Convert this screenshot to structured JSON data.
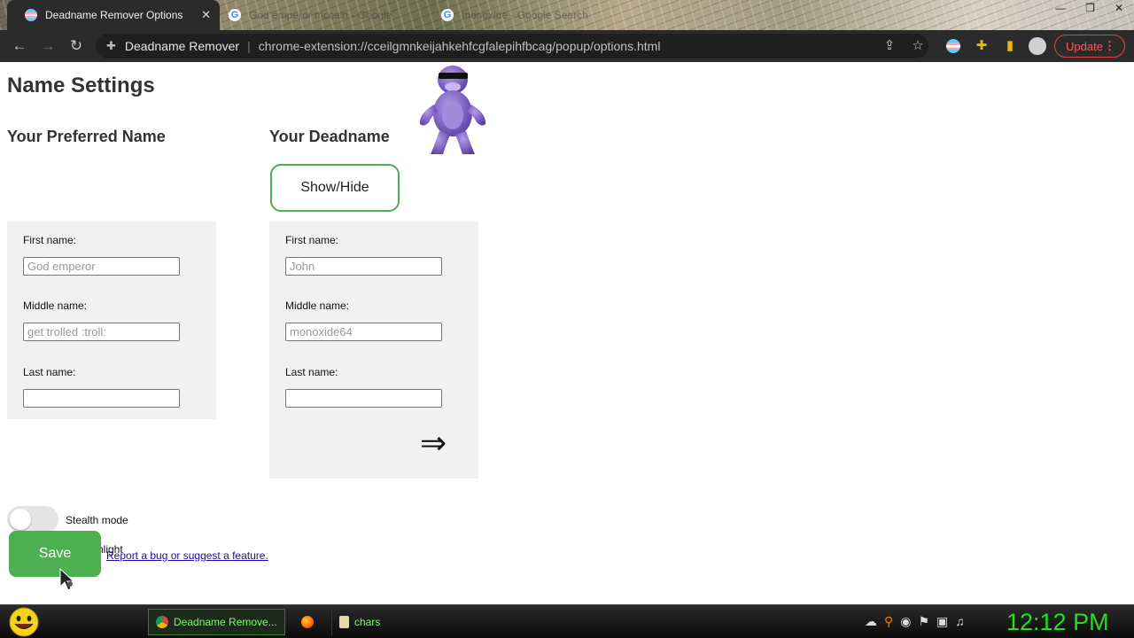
{
  "browser": {
    "tabs": [
      {
        "title": "Deadname Remover Options",
        "favicon": "trans-flag-icon",
        "active": true,
        "close": "✕"
      },
      {
        "title": "God emperor mccain - Google",
        "favicon": "google-icon",
        "active": false
      },
      {
        "title": "monoxide - Google Search",
        "favicon": "google-icon",
        "active": false
      }
    ],
    "window_controls": [
      "—",
      "❐",
      "✕"
    ],
    "toolbar": {
      "site_name": "Deadname Remover",
      "url": "chrome-extension://cceilgmnkeijahkehfcgfalepihfbcag/popup/options.html",
      "update_label": "Update",
      "menu_dots": "⋮"
    }
  },
  "page": {
    "title": "Name Settings",
    "preferred_heading": "Your Preferred Name",
    "deadname_heading": "Your Deadname",
    "show_hide_label": "Show/Hide",
    "preferred": {
      "first_label": "First name:",
      "first_value": "God emperor",
      "middle_label": "Middle name:",
      "middle_value": "get trolled :troll:",
      "last_label": "Last name:",
      "last_value": ""
    },
    "deadname": {
      "first_label": "First name:",
      "first_value": "John",
      "middle_label": "Middle name:",
      "middle_value": "monoxide64",
      "last_label": "Last name:",
      "last_value": ""
    },
    "arrow": "⇒",
    "stealth_label": "Stealth mode",
    "stealth_on": false,
    "highlight_label": "hlight",
    "report_link": "Report a bug or suggest a feature.",
    "save_label": "Save"
  },
  "taskbar": {
    "items": [
      {
        "label": "Deadname Remove...",
        "icon": "chrome-icon",
        "active": true
      },
      {
        "label": "",
        "icon": "firefox-icon",
        "active": false
      },
      {
        "label": "chars",
        "icon": "notepad-icon",
        "active": false
      }
    ],
    "clock": "12:12 PM"
  },
  "colors": {
    "accent_green": "#4caf50",
    "update_red": "#e0463f",
    "clock_green": "#20e020",
    "link_blue": "#1a0dab"
  }
}
